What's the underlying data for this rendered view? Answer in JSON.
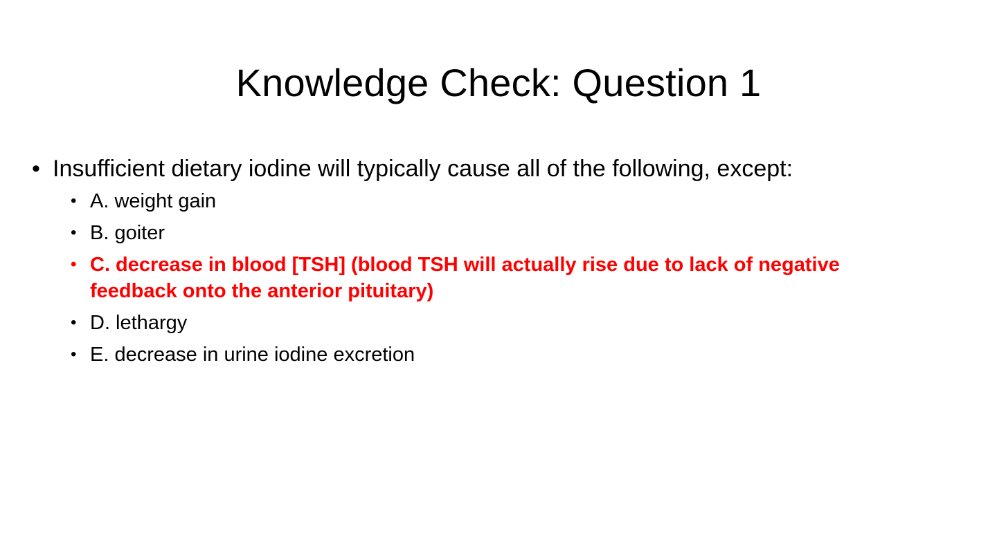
{
  "slide": {
    "title": "Knowledge Check: Question 1",
    "question": "Insufficient dietary iodine will typically cause all of the following, except:",
    "bullet": "•",
    "options": [
      {
        "text": "A. weight gain",
        "correct": false
      },
      {
        "text": "B. goiter",
        "correct": false
      },
      {
        "text": "C. decrease in blood [TSH] (blood TSH will actually rise due to lack of negative feedback onto the anterior pituitary)",
        "correct": true
      },
      {
        "text": "D. lethargy",
        "correct": false
      },
      {
        "text": "E. decrease in urine iodine excretion",
        "correct": false
      }
    ]
  },
  "colors": {
    "background": "#ffffff",
    "text": "#000000",
    "correct_answer": "#ff0000"
  }
}
